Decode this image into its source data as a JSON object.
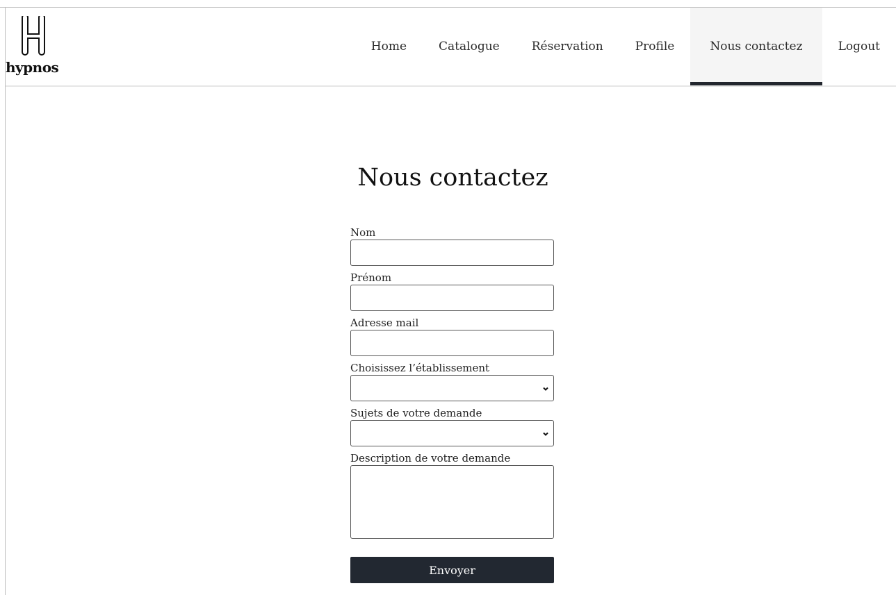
{
  "brand": {
    "name": "hypnos",
    "logo_icon": "letter-h-logo-icon"
  },
  "nav": {
    "items": [
      {
        "label": "Home",
        "active": false
      },
      {
        "label": "Catalogue",
        "active": false
      },
      {
        "label": "Réservation",
        "active": false
      },
      {
        "label": "Profile",
        "active": false
      },
      {
        "label": "Nous contactez",
        "active": true
      },
      {
        "label": "Logout",
        "active": false
      }
    ]
  },
  "page": {
    "title": "Nous contactez"
  },
  "form": {
    "nom_label": "Nom",
    "nom_value": "",
    "prenom_label": "Prénom",
    "prenom_value": "",
    "email_label": "Adresse mail",
    "email_value": "",
    "etablissement_label": "Choisissez l’établissement",
    "etablissement_value": "",
    "sujet_label": "Sujets de votre demande",
    "sujet_value": "",
    "description_label": "Description de votre demande",
    "description_value": "",
    "submit_label": "Envoyer"
  },
  "colors": {
    "accent": "#222831",
    "active_tab_bg": "#f5f5f5"
  }
}
